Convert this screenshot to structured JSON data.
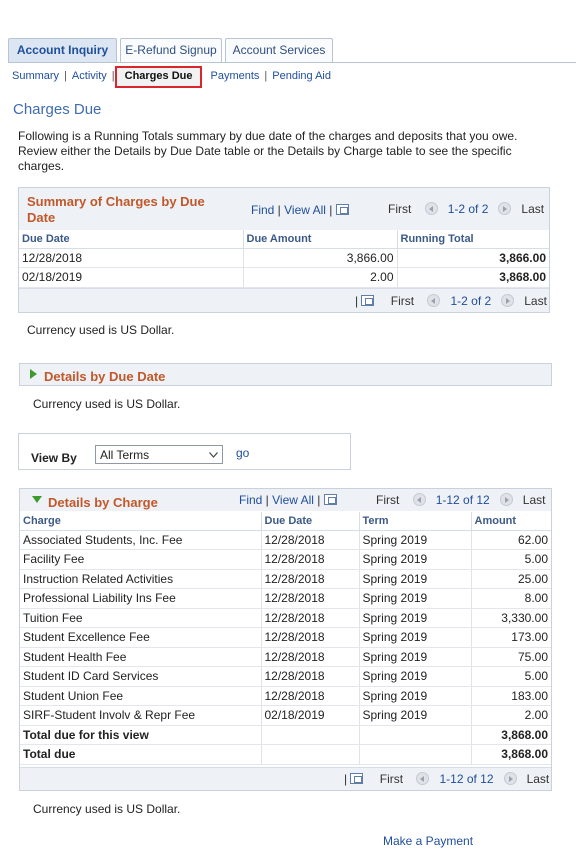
{
  "tabs": [
    "Account Inquiry",
    "E-Refund Signup",
    "Account Services"
  ],
  "subnav": [
    "Summary",
    "Activity",
    "Charges Due",
    "Payments",
    "Pending Aid"
  ],
  "page_title": "Charges Due",
  "intro": "Following is a Running Totals summary by due date of the charges and deposits that you owe. Review either the Details by Due Date table or the Details by Charge table to see the specific charges.",
  "summary": {
    "title_line1": "Summary of Charges by Due",
    "title_line2": "Date",
    "find": "Find",
    "view_all": "View All",
    "first": "First",
    "range": "1-2 of 2",
    "last": "Last",
    "columns": [
      "Due Date",
      "Due Amount",
      "Running Total"
    ],
    "rows": [
      [
        "12/28/2018",
        "3,866.00",
        "3,866.00"
      ],
      [
        "02/18/2019",
        "2.00",
        "3,868.00"
      ]
    ]
  },
  "currency_note": "Currency used is US Dollar.",
  "details_due_date": {
    "title": "Details by Due Date"
  },
  "view_by": {
    "label": "View By",
    "selected": "All Terms",
    "go": "go"
  },
  "details_charge": {
    "title": "Details by Charge",
    "find": "Find",
    "view_all": "View All",
    "first": "First",
    "range": "1-12 of 12",
    "last": "Last",
    "columns": [
      "Charge",
      "Due Date",
      "Term",
      "Amount"
    ],
    "rows": [
      [
        "Associated Students, Inc. Fee",
        "12/28/2018",
        "Spring 2019",
        "62.00"
      ],
      [
        "Facility Fee",
        "12/28/2018",
        "Spring 2019",
        "5.00"
      ],
      [
        "Instruction Related Activities",
        "12/28/2018",
        "Spring 2019",
        "25.00"
      ],
      [
        "Professional Liability Ins Fee",
        "12/28/2018",
        "Spring 2019",
        "8.00"
      ],
      [
        "Tuition Fee",
        "12/28/2018",
        "Spring 2019",
        "3,330.00"
      ],
      [
        "Student Excellence Fee",
        "12/28/2018",
        "Spring 2019",
        "173.00"
      ],
      [
        "Student Health Fee",
        "12/28/2018",
        "Spring 2019",
        "75.00"
      ],
      [
        "Student ID Card Services",
        "12/28/2018",
        "Spring 2019",
        "5.00"
      ],
      [
        "Student Union Fee",
        "12/28/2018",
        "Spring 2019",
        "183.00"
      ],
      [
        "SIRF-Student Involv & Repr Fee",
        "02/18/2019",
        "Spring 2019",
        "2.00"
      ]
    ],
    "total_period_label": "Total due for this view",
    "total_period_value": "3,868.00",
    "total_label": "Total due",
    "total_value": "3,868.00"
  },
  "make_payment": "Make a Payment"
}
